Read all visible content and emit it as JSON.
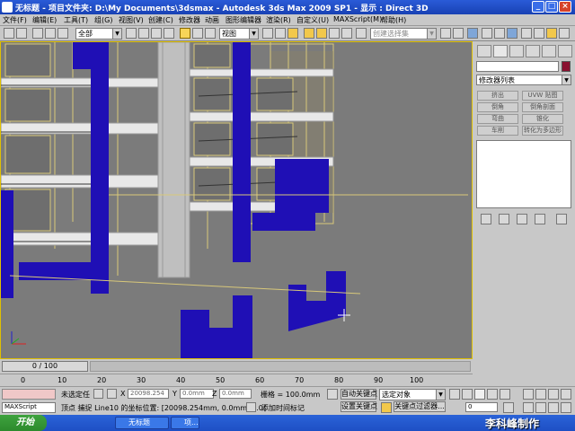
{
  "window": {
    "title": "无标题    - 项目文件夹: D:\\My Documents\\3dsmax    - Autodesk 3ds Max  2009 SP1    - 显示 : Direct 3D",
    "minimize": "_",
    "maximize": "□",
    "close": "×"
  },
  "menu": [
    "文件(F)",
    "编辑(E)",
    "工具(T)",
    "组(G)",
    "视图(V)",
    "创建(C)",
    "修改器",
    "动画",
    "图形编辑器",
    "渲染(R)",
    "自定义(U)",
    "MAXScript(M)",
    "帮助(H)"
  ],
  "toolbar": {
    "selection_filter": "全部",
    "reference_coord": "视图",
    "named_selection_placeholder": "创建选择集"
  },
  "command_panel": {
    "modifier_list": "修改器列表",
    "buttons": [
      "挤出",
      "UVW 贴图",
      "倒角",
      "倒角剖面",
      "弯曲",
      "锥化",
      "车削",
      "转化为多边形"
    ]
  },
  "timeline": {
    "frame_label": "0 / 100",
    "ticks": [
      "0",
      "10",
      "20",
      "30",
      "40",
      "50",
      "60",
      "70",
      "80",
      "90",
      "100"
    ]
  },
  "status": {
    "maxscript_label": "MAXScript",
    "selection_status": "未选定任",
    "x_value": "20098.254",
    "y_value": "0.0mm",
    "z_value": "0.0mm",
    "grid": "栅格 = 100.0mm",
    "autokey": "自动关键点",
    "setkey": "设置关键点",
    "selected_object": "选定对象",
    "key_filters": "关键点过滤器...",
    "prompt": "顶点 捕捉 Line10 的坐标位置:  [20098.254mm, 0.0mm, 0.0(",
    "add_time_tag": "添加时间标记",
    "frame": "0"
  },
  "taskbar": {
    "start": "开始",
    "tasks": [
      "无标题",
      "项..."
    ]
  },
  "watermark": "李科峰制作",
  "colors": {
    "titlebar": "#1841b4",
    "building_blue": "#1f0fb5",
    "building_yellow": "#d8c87a",
    "viewport_bg": "#7b7b7b"
  }
}
